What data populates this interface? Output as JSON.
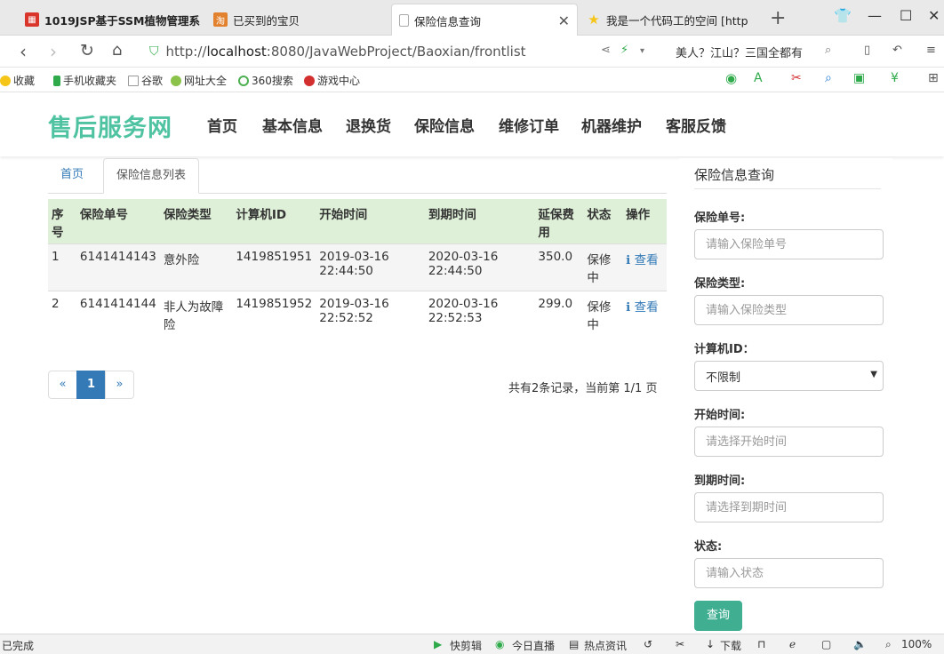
{
  "browser": {
    "tabs": [
      {
        "title": "1019JSP基于SSM植物管理系",
        "fav_color": "#d9352b"
      },
      {
        "title": "已买到的宝贝",
        "fav_color": "#e3822e"
      },
      {
        "title": "保险信息查询",
        "fav_color": "#ffffff"
      },
      {
        "title": "我是一个代码工的空间 [http",
        "fav_color": "#f5c518"
      }
    ],
    "new_tab": "+",
    "url_scheme": "http://",
    "url_host": "localhost",
    "url_rest": ":8080/JavaWebProject/Baoxian/frontlist",
    "search_hint": "美人？江山？三国全都有",
    "bookmarks": [
      "收藏",
      "手机收藏夹",
      "谷歌",
      "网址大全",
      "360搜索",
      "游戏中心"
    ]
  },
  "site": {
    "brand": "售后服务网",
    "nav": [
      "首页",
      "基本信息",
      "退换货",
      "保险信息",
      "维修订单",
      "机器维护",
      "客服反馈"
    ]
  },
  "content": {
    "tabs": {
      "home": "首页",
      "current": "保险信息列表"
    },
    "table": {
      "headers": [
        "序号",
        "保险单号",
        "保险类型",
        "计算机ID",
        "开始时间",
        "到期时间",
        "延保费用",
        "状态",
        "操作"
      ],
      "rows": [
        {
          "no": "1",
          "policy": "6141414143",
          "type": "意外险",
          "pcid": "1419851951",
          "start": "2019-03-16 22:44:50",
          "end": "2020-03-16 22:44:50",
          "fee": "350.0",
          "status": "保修中",
          "action": "查看"
        },
        {
          "no": "2",
          "policy": "6141414144",
          "type": "非人为故障险",
          "pcid": "1419851952",
          "start": "2019-03-16 22:52:52",
          "end": "2020-03-16 22:52:53",
          "fee": "299.0",
          "status": "保修中",
          "action": "查看"
        }
      ]
    },
    "pager": {
      "prev": "«",
      "page": "1",
      "next": "»",
      "info": "共有2条记录，当前第 1/1 页"
    }
  },
  "sidebar": {
    "title": "保险信息查询",
    "fields": {
      "policy_label": "保险单号:",
      "policy_placeholder": "请输入保险单号",
      "type_label": "保险类型:",
      "type_placeholder": "请输入保险类型",
      "pcid_label": "计算机ID：",
      "pcid_value": "不限制",
      "start_label": "开始时间:",
      "start_placeholder": "请选择开始时间",
      "end_label": "到期时间:",
      "end_placeholder": "请选择到期时间",
      "status_label": "状态:",
      "status_placeholder": "请输入状态"
    },
    "query_button": "查询"
  },
  "statusbar": {
    "left": "已完成",
    "items": [
      "快剪辑",
      "今日直播",
      "热点资讯",
      "下载"
    ],
    "zoom": "100%"
  }
}
